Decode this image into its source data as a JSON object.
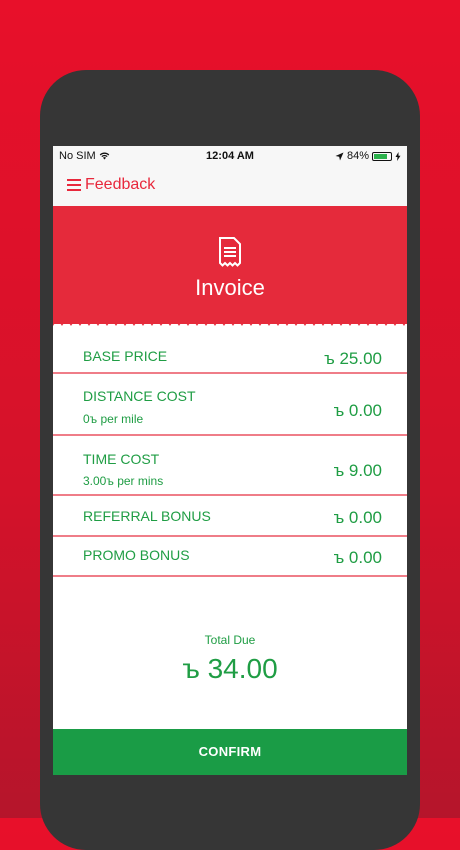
{
  "status_bar": {
    "carrier": "No SIM",
    "time": "12:04 AM",
    "battery_percent": "84%",
    "battery_level": 0.84
  },
  "nav": {
    "title": "Feedback",
    "icon": "hamburger-menu-icon"
  },
  "header": {
    "icon": "receipt-icon",
    "title": "Invoice"
  },
  "items": [
    {
      "label": "BASE PRICE",
      "sub": "",
      "value": "ъ 25.00"
    },
    {
      "label": "DISTANCE COST",
      "sub": "0ъ per mile",
      "value": "ъ 0.00"
    },
    {
      "label": "TIME COST",
      "sub": "3.00ъ per mins",
      "value": "ъ 9.00"
    },
    {
      "label": "REFERRAL BONUS",
      "sub": "",
      "value": "ъ 0.00"
    },
    {
      "label": "PROMO BONUS",
      "sub": "",
      "value": "ъ 0.00"
    }
  ],
  "total": {
    "label": "Total Due",
    "value": "ъ 34.00"
  },
  "confirm_label": "CONFIRM",
  "colors": {
    "brand_red": "#e52a3b",
    "accent_green": "#1f9d44",
    "divider": "#ef7d88"
  }
}
